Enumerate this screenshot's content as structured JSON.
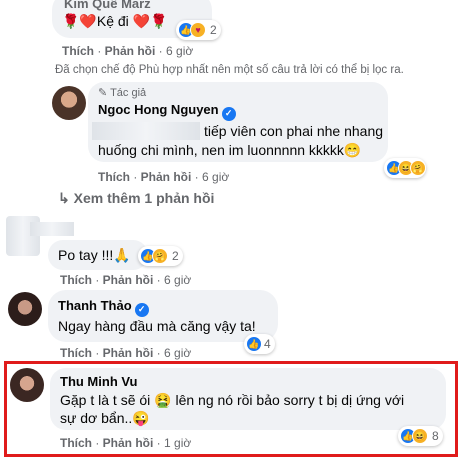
{
  "comments": [
    {
      "name": "Kim Quế Marz",
      "text": "🌹❤️Kệ đi ❤️🌹",
      "actions": {
        "like": "Thích",
        "reply": "Phản hồi",
        "time": "6 giờ"
      },
      "reactions": {
        "count": "2"
      }
    },
    {
      "notice": "Đã chọn chế độ Phù hợp nhất nên một số câu trả lời có thể bị lọc ra."
    },
    {
      "badge": "Tác giả",
      "name": "Ngoc Hong Nguyen",
      "text_line1": "tiếp viên con phai nhe nhang",
      "text_line2": "huống chi mình, nen im luonnnnn kkkkk😁",
      "actions": {
        "like": "Thích",
        "reply": "Phản hồi",
        "time": "6 giờ"
      }
    },
    {
      "see_more": "Xem thêm 1 phản hồi"
    },
    {
      "text": "Po tay !!!🙏",
      "actions": {
        "like": "Thích",
        "reply": "Phản hồi",
        "time": "6 giờ"
      },
      "reactions": {
        "count": "2"
      }
    },
    {
      "name": "Thanh Thảo",
      "text": "Ngay hàng đầu mà căng vậy ta!",
      "actions": {
        "like": "Thích",
        "reply": "Phản hồi",
        "time": "6 giờ"
      },
      "reactions": {
        "count": "4"
      }
    },
    {
      "name": "Thu Minh Vu",
      "text_line1": "Gặp t là t sẽ ói 🤮 lên ng nó rồi bảo sorry t bị dị ứng với",
      "text_line2": "sự dơ bẩn..😜",
      "actions": {
        "like": "Thích",
        "reply": "Phản hồi",
        "time": "1 giờ"
      },
      "reactions": {
        "count": "8"
      }
    }
  ],
  "colors": {
    "bubble": "#f0f2f5",
    "meta": "#65676b",
    "highlight": "#e01b1b",
    "verified": "#1877f2"
  }
}
